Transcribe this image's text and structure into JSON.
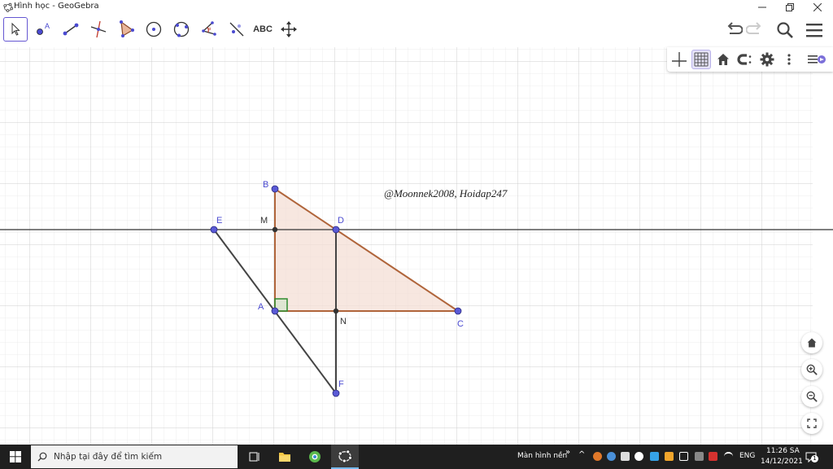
{
  "window": {
    "title": "Hình học - GeoGebra"
  },
  "toolbar": {
    "tools": [
      "move-tool",
      "point-tool",
      "segment-tool",
      "perpendicular-tool",
      "polygon-tool",
      "circle-center-tool",
      "circle-three-points-tool",
      "angle-tool",
      "reflect-tool",
      "text-tool",
      "move-graphics-tool"
    ],
    "text_tool_label": "ABC"
  },
  "graphics": {
    "annotation": "@Moonnek2008, Hoidap247",
    "points": {
      "A": {
        "label": "A"
      },
      "B": {
        "label": "B"
      },
      "C": {
        "label": "C"
      },
      "D": {
        "label": "D"
      },
      "E": {
        "label": "E"
      },
      "F": {
        "label": "F"
      },
      "M": {
        "label": "M"
      },
      "N": {
        "label": "N"
      }
    },
    "colors": {
      "triangle_fill": "#f4dfd5",
      "triangle_edge": "#b0653b",
      "free_point": "#5a5ad6",
      "line": "#333333",
      "right_angle": "#2e8b2e"
    }
  },
  "taskbar": {
    "search_placeholder": "Nhập tại đây để tìm kiếm",
    "desktop_label": "Màn hình nền",
    "language": "ENG",
    "time": "11:26 SA",
    "date": "14/12/2021",
    "notification_count": "1"
  }
}
